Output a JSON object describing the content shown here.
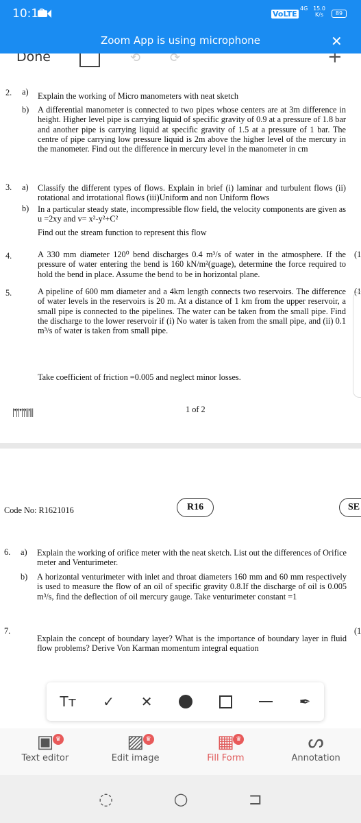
{
  "status": {
    "time": "10:13",
    "volte": "VoLTE",
    "network": "4G",
    "speed": "15.0 K/s",
    "battery": "89"
  },
  "banner": {
    "text": "Zoom App is using microphone"
  },
  "topbar": {
    "done": "Done"
  },
  "page1": {
    "q2": {
      "num": "2.",
      "a_label": "a)",
      "a": "Explain the working of Micro manometers with neat sketch",
      "b_label": "b)",
      "b": "A differential manometer is connected to two pipes whose centers are at 3m difference in height. Higher level pipe is carrying liquid of specific gravity of 0.9 at a pressure of 1.8 bar and another pipe is carrying liquid at specific gravity of 1.5 at a pressure of 1 bar. The centre of pipe carrying low pressure liquid is 2m above the higher level of the mercury in the manometer. Find out the difference in mercury level in the manometer in cm"
    },
    "q3": {
      "num": "3.",
      "a_label": "a)",
      "a": "Classify the different types of flows. Explain in brief (i) laminar and turbulent flows (ii) rotational and irrotational flows (iii)Uniform and non Uniform flows",
      "b_label": "b)",
      "b": "In a particular steady state, incompressible flow field, the velocity components are given as u =2xy and v= x²-y²+C²",
      "b2": "Find out the stream function to represent this flow"
    },
    "q4": {
      "num": "4.",
      "text": "A 330 mm diameter 120⁰ bend discharges 0.4 m³/s of water in the atmosphere. If the pressure of water entering the bend is 160 kN/m²(guage), determine the force required to hold the bend in place. Assume the bend to be in horizontal plane.",
      "marks": "(1"
    },
    "q5": {
      "num": "5.",
      "text": "A pipeline of 600 mm diameter and a 4km length connects two reservoirs. The difference of water levels in the reservoirs is 20 m. At a distance of 1 km from the upper reservoir, a small pipe is connected to the pipelines. The water can be taken from the small pipe. Find the discharge to the lower reservoir if (i) No water is taken from the small pipe, and (ii) 0.1 m³/s of water is taken from small pipe.",
      "text2": "Take coefficient of friction =0.005 and neglect minor losses.",
      "marks": "(1"
    },
    "barcode": "|''|'|''|'|'||'|||",
    "page_num": "1 of 2"
  },
  "page2": {
    "code": "Code No: R1621016",
    "reg": "R16",
    "set": "SE",
    "q6": {
      "num": "6.",
      "a_label": "a)",
      "a": "Explain the working of orifice meter with the neat sketch. List out the differences of Orifice meter and Venturimeter.",
      "b_label": "b)",
      "b": "A horizontal venturimeter with inlet and throat diameters 160 mm and 60 mm respectively is used to measure the flow of an oil of specific gravity 0.8.If the discharge of oil is 0.005 m³/s, find the deflection of oil mercury gauge. Take venturimeter constant =1"
    },
    "q7": {
      "num": "7.",
      "text": "Explain the concept of boundary layer? What is the importance of boundary layer in fluid flow problems? Derive Von Karman momentum integral equation",
      "marks": "(1"
    }
  },
  "annot_tools": [
    "text-size",
    "check",
    "cross",
    "dot",
    "rectangle",
    "line",
    "pen"
  ],
  "tools": [
    {
      "label": "Text editor",
      "premium": true
    },
    {
      "label": "Edit image",
      "premium": true
    },
    {
      "label": "Fill Form",
      "premium": true,
      "active": true
    },
    {
      "label": "Annotation",
      "premium": false
    }
  ],
  "colors": {
    "status_bar": "#1a8cf2",
    "active_tool": "#e05a5a",
    "premium_badge": "#e85a5a"
  }
}
